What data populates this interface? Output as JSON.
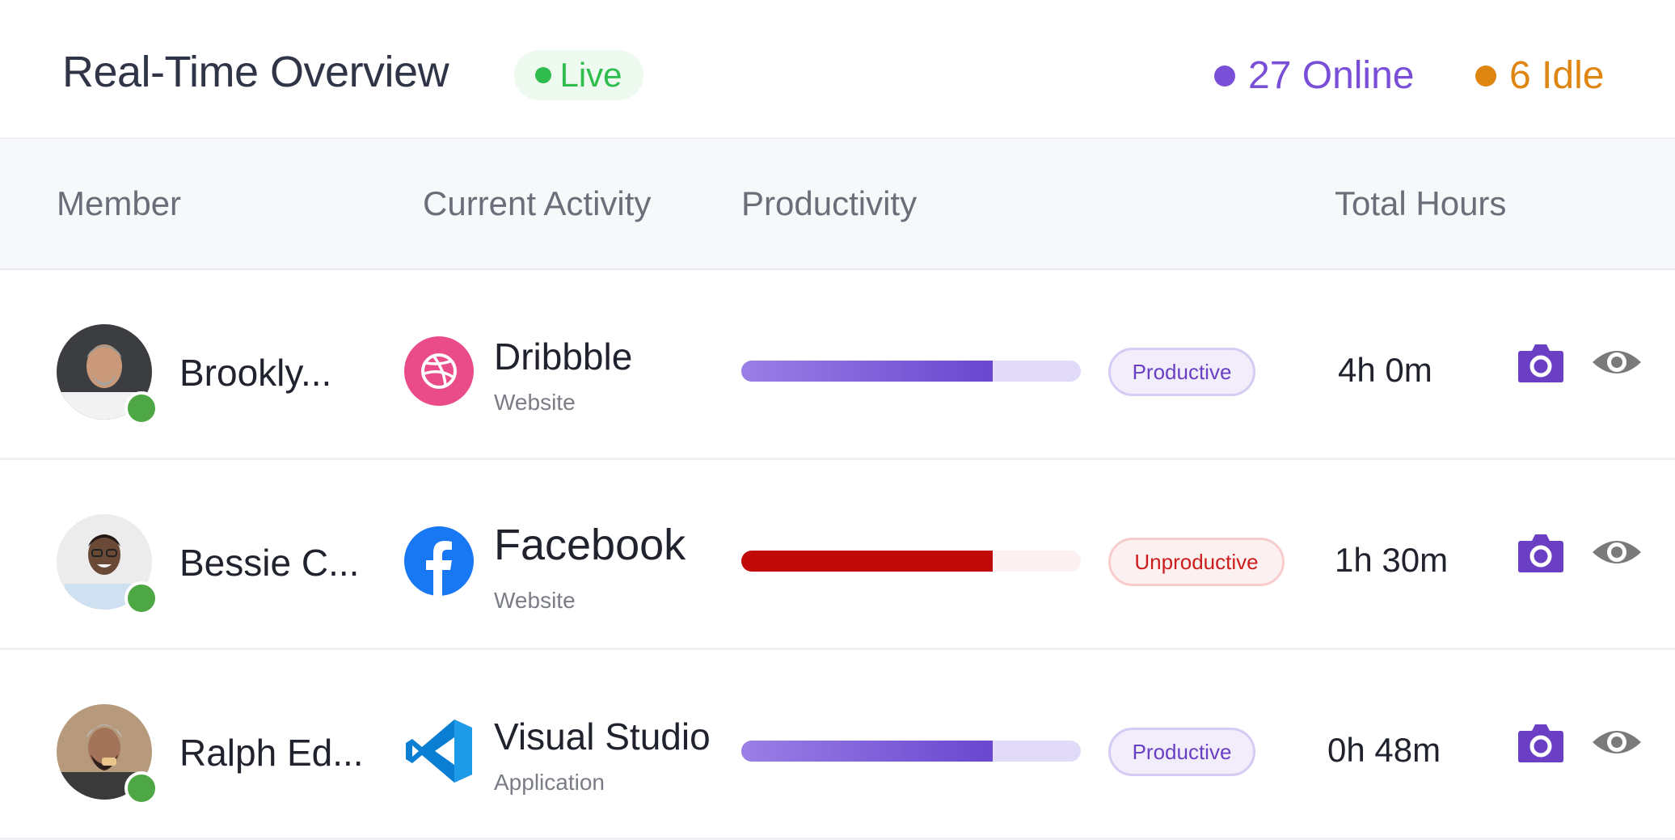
{
  "header": {
    "title": "Real-Time Overview",
    "live_label": "Live",
    "online": "27 Online",
    "idle": "6 Idle",
    "colors": {
      "online": "#7a4fd8",
      "idle": "#df8511",
      "live": "#2fbd4f"
    }
  },
  "table": {
    "columns": [
      "Member",
      "Current Activity",
      "Productivity",
      "Total Hours"
    ],
    "rows": [
      {
        "member": "Brookly...",
        "activity": "Dribbble",
        "activity_type": "Website",
        "activity_icon": "dribbble-icon",
        "productivity_fraction": 0.74,
        "status": "Productive",
        "hours": "4h 0m"
      },
      {
        "member": "Bessie C...",
        "activity": "Facebook",
        "activity_type": "Website",
        "activity_icon": "facebook-icon",
        "productivity_fraction": 0.74,
        "status": "Unproductive",
        "hours": "1h 30m"
      },
      {
        "member": "Ralph Ed...",
        "activity": "Visual Studio",
        "activity_type": "Application",
        "activity_icon": "visual-studio-icon",
        "productivity_fraction": 0.74,
        "status": "Productive",
        "hours": "0h 48m"
      }
    ],
    "row_actions": [
      "camera-icon",
      "eye-icon"
    ]
  }
}
